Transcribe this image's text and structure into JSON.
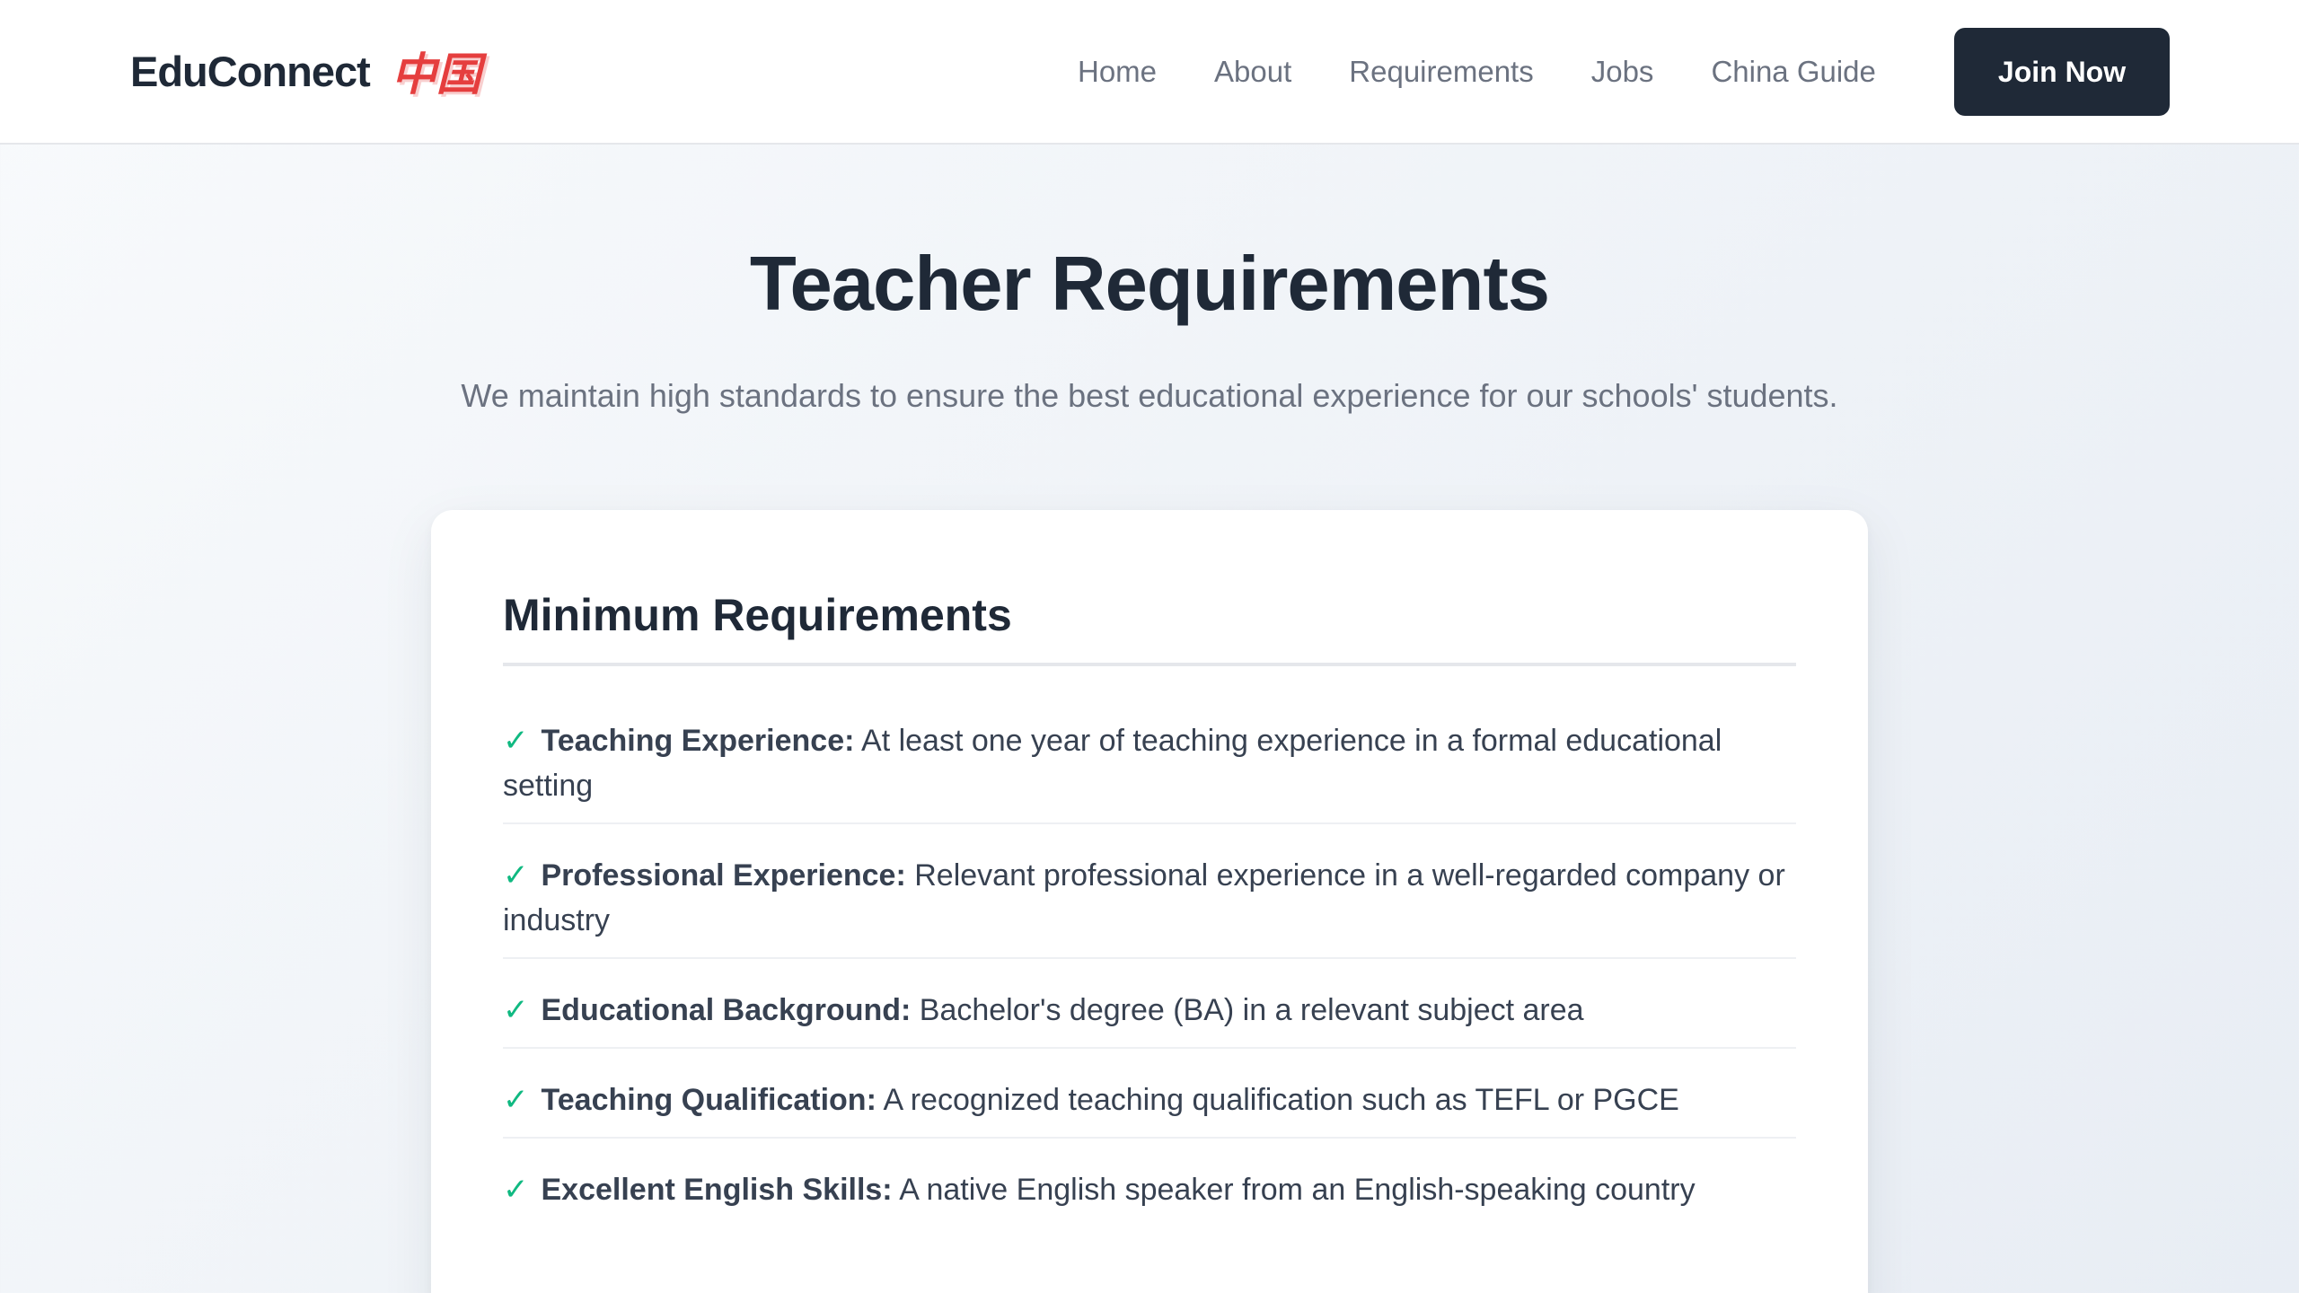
{
  "brand": {
    "name": "EduConnect",
    "chinese": "中国"
  },
  "nav": {
    "links": [
      "Home",
      "About",
      "Requirements",
      "Jobs",
      "China Guide"
    ],
    "cta": "Join Now"
  },
  "hero": {
    "title": "Teacher Requirements",
    "subtitle": "We maintain high standards to ensure the best educational experience for our schools' students."
  },
  "card": {
    "title": "Minimum Requirements",
    "check_icon": "✓",
    "items": [
      {
        "label": "Teaching Experience:",
        "text": "At least one year of teaching experience in a formal educational setting"
      },
      {
        "label": "Professional Experience:",
        "text": "Relevant professional experience in a well-regarded company or industry"
      },
      {
        "label": "Educational Background:",
        "text": "Bachelor's degree (BA) in a relevant subject area"
      },
      {
        "label": "Teaching Qualification:",
        "text": "A recognized teaching qualification such as TEFL or PGCE"
      },
      {
        "label": "Excellent English Skills:",
        "text": "A native English speaker from an English-speaking country"
      }
    ]
  },
  "colors": {
    "accent": "#e53e3e",
    "check": "#10b981",
    "dark": "#1f2937",
    "muted": "#6b7280"
  }
}
